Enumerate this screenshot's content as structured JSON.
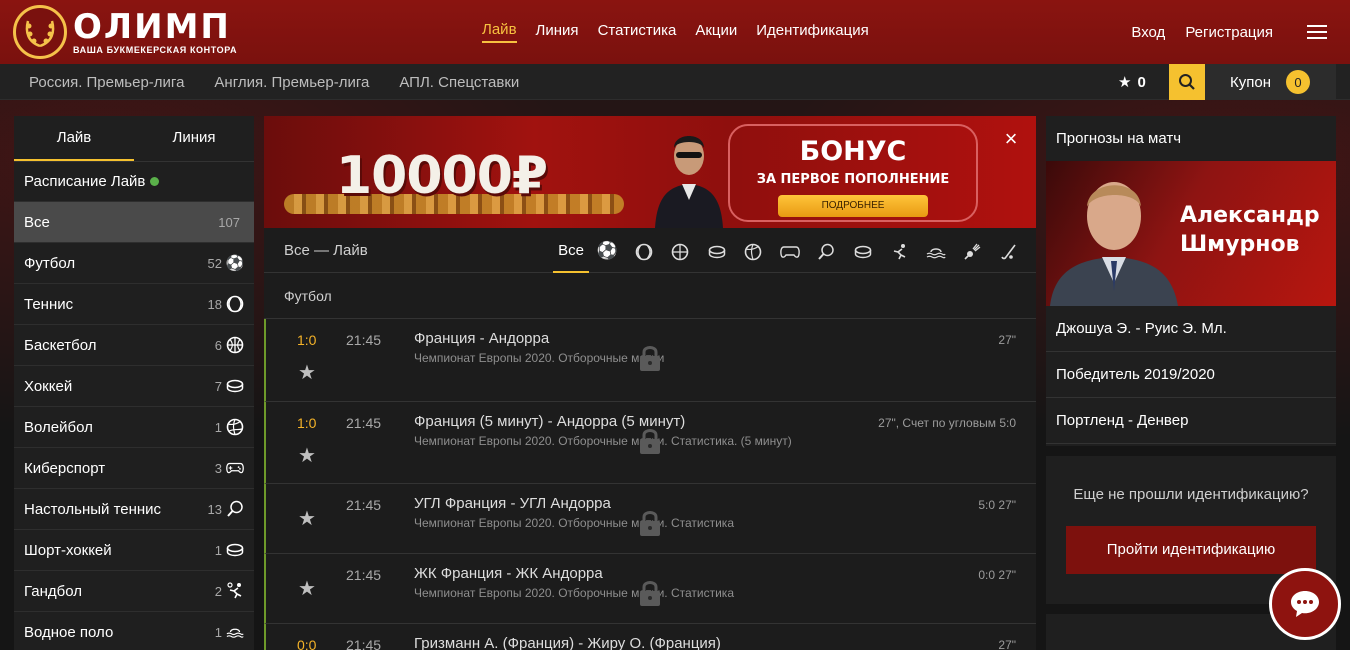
{
  "header": {
    "logo_name": "ОЛИМП",
    "logo_subtitle": "ВАША БУКМЕКЕРСКАЯ КОНТОРА",
    "nav": [
      "Лайв",
      "Линия",
      "Статистика",
      "Акции",
      "Идентификация"
    ],
    "active_nav": "Лайв",
    "login": "Вход",
    "register": "Регистрация"
  },
  "subbar": {
    "links": [
      "Россия. Премьер-лига",
      "Англия. Премьер-лига",
      "АПЛ. Спецставки"
    ],
    "favorites_count": "0",
    "coupon_label": "Купон",
    "coupon_count": "0"
  },
  "sidebar": {
    "tabs": [
      "Лайв",
      "Линия"
    ],
    "live_schedule": "Расписание Лайв",
    "items": [
      {
        "label": "Все",
        "count": "107",
        "icon": "none"
      },
      {
        "label": "Футбол",
        "count": "52",
        "icon": "soccer-ball-icon"
      },
      {
        "label": "Теннис",
        "count": "18",
        "icon": "tennis-ball-icon"
      },
      {
        "label": "Баскетбол",
        "count": "6",
        "icon": "basketball-icon"
      },
      {
        "label": "Хоккей",
        "count": "7",
        "icon": "hockey-puck-icon"
      },
      {
        "label": "Волейбол",
        "count": "1",
        "icon": "volleyball-icon"
      },
      {
        "label": "Киберспорт",
        "count": "3",
        "icon": "gamepad-icon"
      },
      {
        "label": "Настольный теннис",
        "count": "13",
        "icon": "ping-pong-icon"
      },
      {
        "label": "Шорт-хоккей",
        "count": "1",
        "icon": "hockey-puck-icon"
      },
      {
        "label": "Гандбол",
        "count": "2",
        "icon": "handball-icon"
      },
      {
        "label": "Водное поло",
        "count": "1",
        "icon": "water-polo-icon"
      }
    ]
  },
  "banner": {
    "amount": "10000₽",
    "title": "БОНУС",
    "subtitle": "ЗА ПЕРВОЕ ПОПОЛНЕНИЕ",
    "button": "ПОДРОБНЕЕ"
  },
  "events_header": {
    "title": "Все — Лайв",
    "all_tab": "Все"
  },
  "section_title": "Футбол",
  "events": [
    {
      "score": "1:0",
      "time": "21:45",
      "title": "Франция - Андорра",
      "league": "Чемпионат Европы 2020. Отборочные матчи",
      "meta": "27\""
    },
    {
      "score": "1:0",
      "time": "21:45",
      "title": "Франция (5 минут) - Андорра (5 минут)",
      "league": "Чемпионат Европы 2020. Отборочные матчи. Статистика. (5 минут)",
      "meta": "27\", Счет по угловым 5:0"
    },
    {
      "score": "",
      "time": "21:45",
      "title": "УГЛ Франция - УГЛ Андорра",
      "league": "Чемпионат Европы 2020. Отборочные матчи. Статистика",
      "meta": "5:0 27\""
    },
    {
      "score": "",
      "time": "21:45",
      "title": "ЖК Франция - ЖК Андорра",
      "league": "Чемпионат Европы 2020. Отборочные матчи. Статистика",
      "meta": "0:0 27\""
    },
    {
      "score": "0:0",
      "time": "21:45",
      "title": "Гризманн А. (Франция) - Жиру О. (Франция)",
      "league": "",
      "meta": "27\""
    }
  ],
  "right": {
    "title": "Прогнозы на матч",
    "expert_name_line1": "Александр",
    "expert_name_line2": "Шмурнов",
    "items": [
      "Джошуа Э. - Руис Э. Мл.",
      "Победитель 2019/2020",
      "Портленд - Денвер"
    ],
    "ident_question": "Еще не прошли идентификацию?",
    "ident_button": "Пройти идентификацию"
  },
  "colors": {
    "brand_red": "#8a1410",
    "accent_yellow": "#f5c12f",
    "live_green": "#5ab04a"
  }
}
